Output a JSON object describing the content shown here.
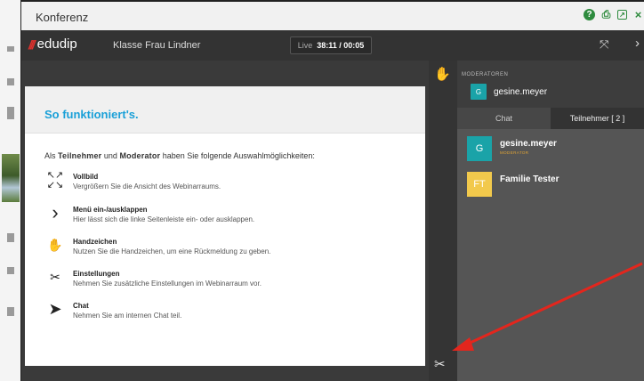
{
  "window": {
    "title": "Konferenz",
    "title_icons": [
      "help-icon",
      "print-icon",
      "external-window-icon",
      "close-icon"
    ],
    "close_glyph": "×"
  },
  "header": {
    "logo": "edudip",
    "class_name": "Klasse Frau Lindner",
    "live_label": "Live",
    "live_time": "38:11 / 00:05",
    "icons": [
      "fullscreen-icon",
      "chevron-right-icon"
    ]
  },
  "help": {
    "title": "So funktioniert's.",
    "intro_prefix": "Als",
    "intro_role1": "Teilnehmer",
    "intro_and": "und",
    "intro_role2": "Moderator",
    "intro_suffix": "haben Sie folgende Auswahlmöglichkeiten:",
    "items": [
      {
        "icon": "fullscreen-icon",
        "title": "Vollbild",
        "text": "Vergrößern Sie die Ansicht des Webinarraums."
      },
      {
        "icon": "chevron-right-icon",
        "title": "Menü ein-/ausklappen",
        "text": "Hier lässt sich die linke Seitenleiste ein- oder ausklappen."
      },
      {
        "icon": "hand-icon",
        "title": "Handzeichen",
        "text": "Nutzen Sie die Handzeichen, um eine Rückmeldung zu geben."
      },
      {
        "icon": "tools-icon",
        "title": "Einstellungen",
        "text": "Nehmen Sie zusätzliche Einstellungen im Webinarraum vor."
      },
      {
        "icon": "send-icon",
        "title": "Chat",
        "text": "Nehmen Sie am internen Chat teil."
      }
    ]
  },
  "sidebar": {
    "moderators_label": "MODERATOREN",
    "moderator": {
      "initial": "G",
      "name": "gesine.meyer"
    },
    "tabs": [
      {
        "label": "Chat"
      },
      {
        "label": "Teilnehmer [ 2 ]"
      }
    ],
    "participants": [
      {
        "initials": "G",
        "name": "gesine.meyer",
        "role": "MODERATOR",
        "color": "#1aa3a8"
      },
      {
        "initials": "FT",
        "name": "Familie Tester",
        "role": "",
        "color": "#f2c94c"
      }
    ]
  },
  "colors": {
    "accent": "#1aa0d8",
    "brand_red": "#e0312d",
    "titlebar_icons": "#2e8b3e",
    "annotation_arrow": "#e3261d"
  }
}
